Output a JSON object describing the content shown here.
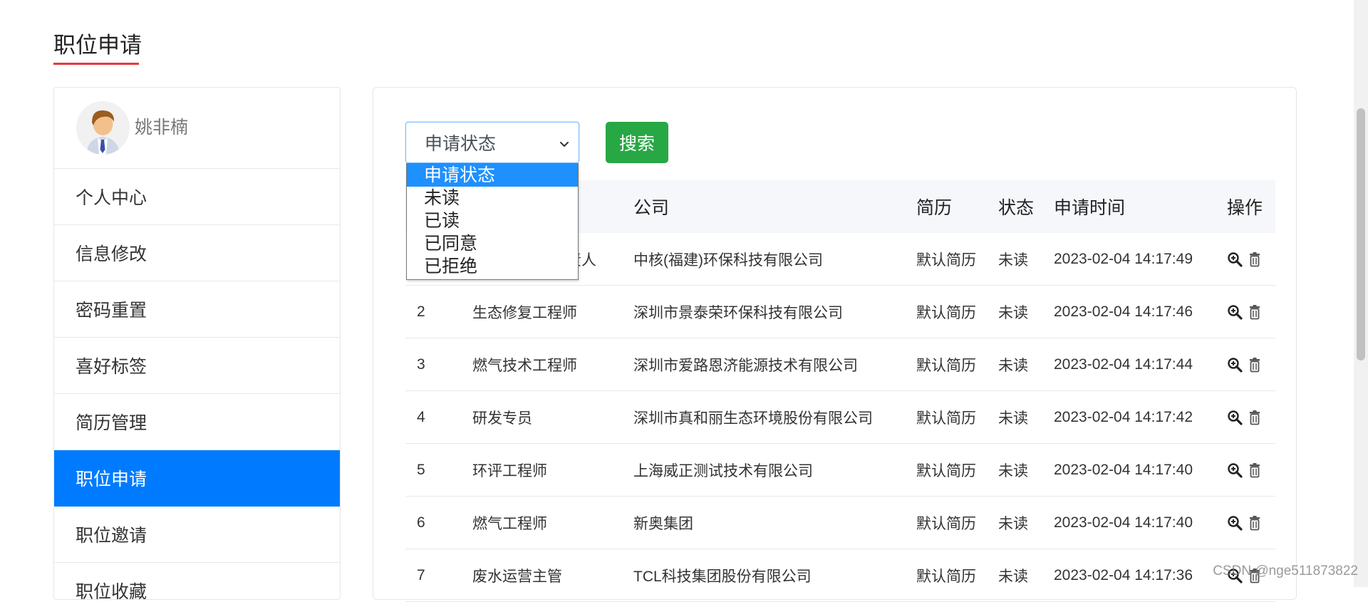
{
  "page": {
    "title": "职位申请"
  },
  "sidebar": {
    "username": "姚非楠",
    "items": [
      {
        "label": "个人中心",
        "active": false
      },
      {
        "label": "信息修改",
        "active": false
      },
      {
        "label": "密码重置",
        "active": false
      },
      {
        "label": "喜好标签",
        "active": false
      },
      {
        "label": "简历管理",
        "active": false
      },
      {
        "label": "职位申请",
        "active": true
      },
      {
        "label": "职位邀请",
        "active": false
      },
      {
        "label": "职位收藏",
        "active": false
      }
    ]
  },
  "filter": {
    "select_value": "申请状态",
    "options": [
      "申请状态",
      "未读",
      "已读",
      "已同意",
      "已拒绝"
    ],
    "search_label": "搜索"
  },
  "table": {
    "headers": {
      "no": "",
      "position": "",
      "company": "公司",
      "resume": "简历",
      "status": "状态",
      "time": "申请时间",
      "ops": "操作"
    },
    "rows": [
      {
        "no": "",
        "position": "责人",
        "company": "中核(福建)环保科技有限公司",
        "resume": "默认简历",
        "status": "未读",
        "time": "2023-02-04 14:17:49"
      },
      {
        "no": "2",
        "position": "生态修复工程师",
        "company": "深圳市景泰荣环保科技有限公司",
        "resume": "默认简历",
        "status": "未读",
        "time": "2023-02-04 14:17:46"
      },
      {
        "no": "3",
        "position": "燃气技术工程师",
        "company": "深圳市爱路恩济能源技术有限公司",
        "resume": "默认简历",
        "status": "未读",
        "time": "2023-02-04 14:17:44"
      },
      {
        "no": "4",
        "position": "研发专员",
        "company": "深圳市真和丽生态环境股份有限公司",
        "resume": "默认简历",
        "status": "未读",
        "time": "2023-02-04 14:17:42"
      },
      {
        "no": "5",
        "position": "环评工程师",
        "company": "上海威正测试技术有限公司",
        "resume": "默认简历",
        "status": "未读",
        "time": "2023-02-04 14:17:40"
      },
      {
        "no": "6",
        "position": "燃气工程师",
        "company": "新奥集团",
        "resume": "默认简历",
        "status": "未读",
        "time": "2023-02-04 14:17:40"
      },
      {
        "no": "7",
        "position": "废水运营主管",
        "company": "TCL科技集团股份有限公司",
        "resume": "默认简历",
        "status": "未读",
        "time": "2023-02-04 14:17:36"
      }
    ]
  },
  "icons": {
    "view": "zoom-in-icon",
    "delete": "trash-icon",
    "chevron": "chevron-down-icon"
  },
  "watermark": "CSDN @nge511873822",
  "colors": {
    "active_nav": "#007bff",
    "search_button": "#28a745",
    "title_underline": "#e4393c",
    "dropdown_highlight": "#1e90ff"
  }
}
